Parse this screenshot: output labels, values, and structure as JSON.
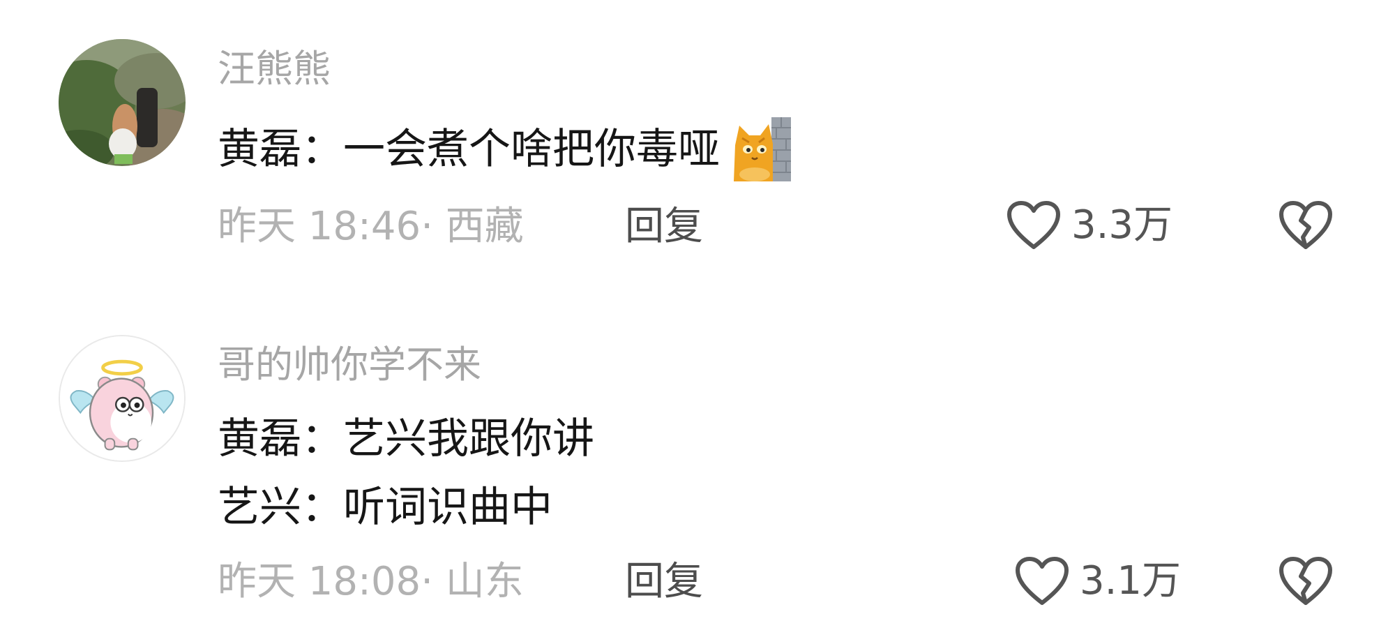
{
  "comments": [
    {
      "username": "汪熊熊",
      "lines": [
        "黄磊：一会煮个啥把你毒哑"
      ],
      "emoji": "cat-peeking-emoji",
      "time": "昨天 18:46",
      "location": "· 西藏",
      "reply_label": "回复",
      "likes": "3.3万"
    },
    {
      "username": "哥的帅你学不来",
      "lines": [
        "黄磊：艺兴我跟你讲",
        "艺兴：听词识曲中"
      ],
      "time": "昨天 18:08",
      "location": "· 山东",
      "reply_label": "回复",
      "likes": "3.1万"
    }
  ],
  "icons": {
    "like": "heart-outline-icon",
    "dislike": "broken-heart-icon"
  },
  "colors": {
    "username": "#a6a6a6",
    "body_text": "#161616",
    "meta_text": "#b2b2b2",
    "reply_text": "#4d4d4d",
    "icon_stroke": "#555555",
    "emoji_cat": "#f0a422"
  }
}
